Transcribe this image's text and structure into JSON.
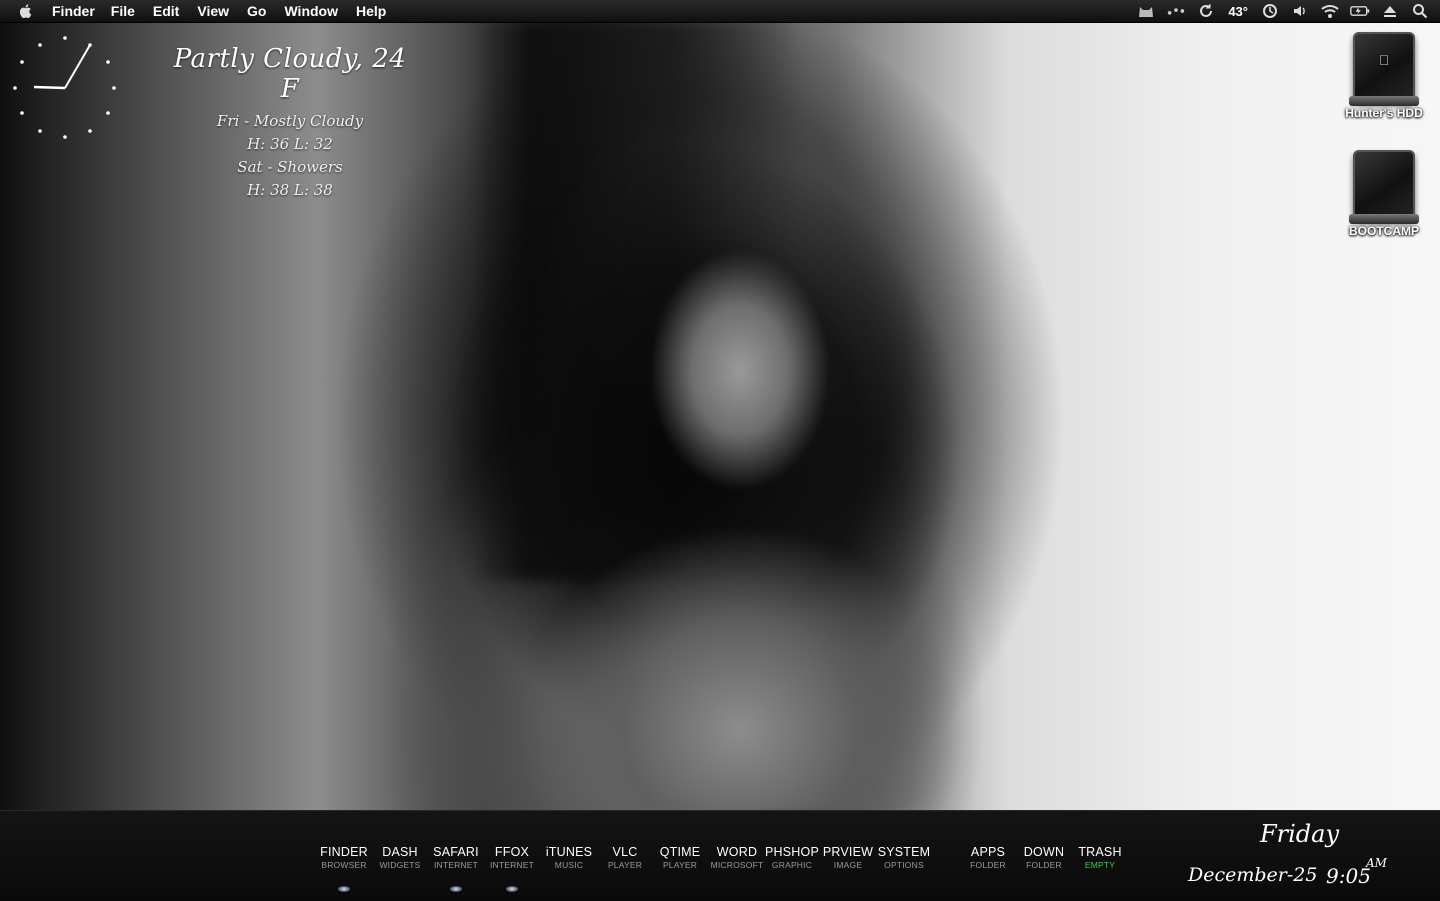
{
  "menubar": {
    "app_name": "Finder",
    "items": [
      "File",
      "Edit",
      "View",
      "Go",
      "Window",
      "Help"
    ],
    "temperature": "43°"
  },
  "weather": {
    "current": "Partly Cloudy, 24 F",
    "forecast": [
      "Fri - Mostly Cloudy",
      "H: 36  L: 32",
      "Sat - Showers",
      "H: 38  L: 38"
    ]
  },
  "desktop": {
    "drives": [
      "Hunter's HDD",
      "BOOTCAMP"
    ]
  },
  "dock": {
    "items": [
      {
        "label": "FINDER",
        "sub": "BROWSER"
      },
      {
        "label": "DASH",
        "sub": "WIDGETS"
      },
      {
        "label": "SAFARI",
        "sub": "INTERNET"
      },
      {
        "label": "FFOX",
        "sub": "INTERNET"
      },
      {
        "label": "iTUNES",
        "sub": "MUSIC"
      },
      {
        "label": "VLC",
        "sub": "PLAYER"
      },
      {
        "label": "QTIME",
        "sub": "PLAYER"
      },
      {
        "label": "WORD",
        "sub": "MICROSOFT"
      },
      {
        "label": "PHSHOP",
        "sub": "GRAPHIC"
      },
      {
        "label": "PRVIEW",
        "sub": "IMAGE"
      },
      {
        "label": "SYSTEM",
        "sub": "OPTIONS"
      },
      {
        "label": "APPS",
        "sub": "FOLDER"
      },
      {
        "label": "DOWN",
        "sub": "FOLDER"
      },
      {
        "label": "TRASH",
        "sub": "EMPTY"
      }
    ],
    "trash_status_color": "#35d048"
  },
  "datetime": {
    "day": "Friday",
    "date": "December-25",
    "time": "9:05",
    "ampm": "AM"
  }
}
